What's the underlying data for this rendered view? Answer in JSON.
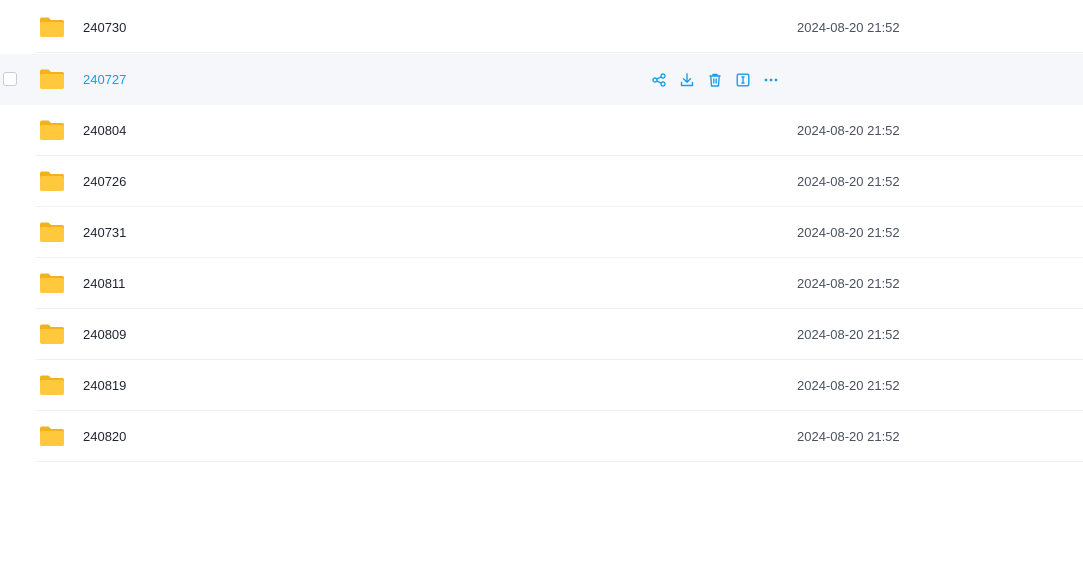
{
  "colors": {
    "accent": "#1a9ee6",
    "folder_front": "#ffc83d",
    "folder_back": "#f2b21b",
    "row_hover_bg": "#f6f7fa",
    "text_primary": "#1f2430",
    "text_secondary": "#4b5261"
  },
  "files": [
    {
      "name": "240730",
      "modified": "2024-08-20 21:52",
      "icon": "folder-icon"
    },
    {
      "name": "240727",
      "modified": "",
      "icon": "folder-icon",
      "hovered": true,
      "actions": [
        "share-icon",
        "download-icon",
        "delete-icon",
        "rename-icon",
        "more-icon"
      ]
    },
    {
      "name": "240804",
      "modified": "2024-08-20 21:52",
      "icon": "folder-icon"
    },
    {
      "name": "240726",
      "modified": "2024-08-20 21:52",
      "icon": "folder-icon"
    },
    {
      "name": "240731",
      "modified": "2024-08-20 21:52",
      "icon": "folder-icon"
    },
    {
      "name": "240811",
      "modified": "2024-08-20 21:52",
      "icon": "folder-icon"
    },
    {
      "name": "240809",
      "modified": "2024-08-20 21:52",
      "icon": "folder-icon"
    },
    {
      "name": "240819",
      "modified": "2024-08-20 21:52",
      "icon": "folder-icon"
    },
    {
      "name": "240820",
      "modified": "2024-08-20 21:52",
      "icon": "folder-icon"
    }
  ]
}
